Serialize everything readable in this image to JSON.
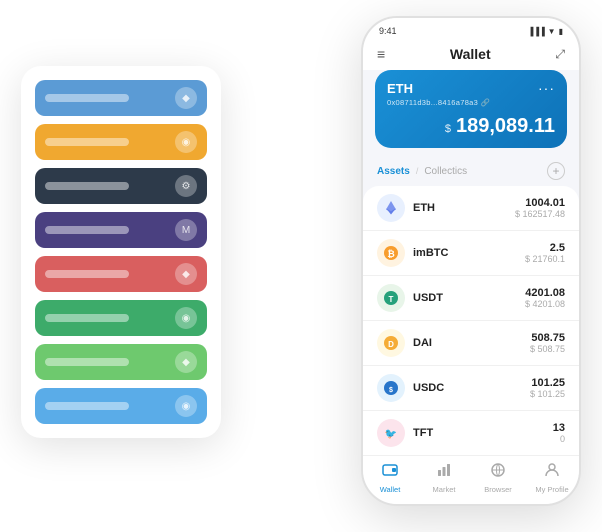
{
  "scene": {
    "cards": [
      {
        "color": "card-blue",
        "icon": "◆"
      },
      {
        "color": "card-orange",
        "icon": "◉"
      },
      {
        "color": "card-dark",
        "icon": "◈"
      },
      {
        "color": "card-purple",
        "icon": "M"
      },
      {
        "color": "card-red",
        "icon": "◆"
      },
      {
        "color": "card-green",
        "icon": "◉"
      },
      {
        "color": "card-light-green",
        "icon": "◆"
      },
      {
        "color": "card-sky",
        "icon": "◉"
      }
    ],
    "phone": {
      "status_time": "9:41",
      "header_title": "Wallet",
      "eth_card": {
        "symbol": "ETH",
        "address": "0x08711d3b...8416a78a3",
        "address_suffix": "🔗",
        "amount": "$ 189,089.11",
        "currency_symbol": "$"
      },
      "assets_tab_active": "Assets",
      "assets_tab_divider": "/",
      "assets_tab_inactive": "Collectics",
      "assets": [
        {
          "name": "ETH",
          "amount_primary": "1004.01",
          "amount_usd": "$ 162517.48",
          "icon_type": "eth"
        },
        {
          "name": "imBTC",
          "amount_primary": "2.5",
          "amount_usd": "$ 21760.1",
          "icon_type": "imbtc"
        },
        {
          "name": "USDT",
          "amount_primary": "4201.08",
          "amount_usd": "$ 4201.08",
          "icon_type": "usdt"
        },
        {
          "name": "DAI",
          "amount_primary": "508.75",
          "amount_usd": "$ 508.75",
          "icon_type": "dai"
        },
        {
          "name": "USDC",
          "amount_primary": "101.25",
          "amount_usd": "$ 101.25",
          "icon_type": "usdc"
        },
        {
          "name": "TFT",
          "amount_primary": "13",
          "amount_usd": "0",
          "icon_type": "tft"
        }
      ],
      "nav": [
        {
          "label": "Wallet",
          "icon": "wallet",
          "active": true
        },
        {
          "label": "Market",
          "icon": "market",
          "active": false
        },
        {
          "label": "Browser",
          "icon": "browser",
          "active": false
        },
        {
          "label": "My Profile",
          "icon": "profile",
          "active": false
        }
      ]
    }
  }
}
